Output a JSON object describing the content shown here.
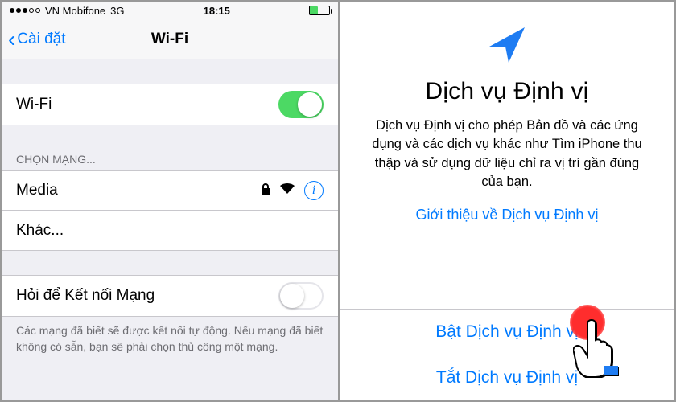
{
  "left": {
    "status": {
      "carrier": "VN Mobifone",
      "network": "3G",
      "time": "18:15"
    },
    "nav": {
      "back": "Cài đặt",
      "title": "Wi-Fi"
    },
    "wifi_row": {
      "label": "Wi-Fi"
    },
    "choose_network_header": "CHỌN MẠNG...",
    "networks": {
      "media": "Media",
      "other": "Khác..."
    },
    "ask_row": {
      "label": "Hỏi để Kết nối Mạng"
    },
    "footer": "Các mạng đã biết sẽ được kết nối tự động. Nếu mạng đã biết không có sẵn, bạn sẽ phải chọn thủ công một mạng."
  },
  "right": {
    "title": "Dịch vụ Định vị",
    "desc": "Dịch vụ Định vị cho phép Bản đồ và các ứng dụng và các dịch vụ khác như Tìm iPhone thu thập và sử dụng dữ liệu chỉ ra vị trí gần đúng của bạn.",
    "about_link": "Giới thiệu về Dịch vụ Định vị",
    "enable_btn": "Bật Dịch vụ Định vị",
    "disable_btn": "Tắt Dịch vụ Định vị"
  }
}
